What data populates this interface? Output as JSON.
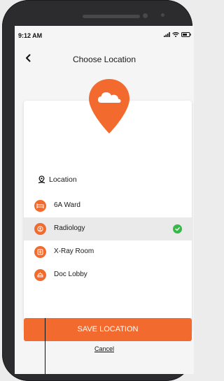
{
  "status_bar": {
    "time": "9:12 AM"
  },
  "header": {
    "title": "Choose Location",
    "back_icon": "chevron-left-icon"
  },
  "card": {
    "pin_icon": "cloud-map-pin-icon",
    "section_label": "Location",
    "section_icon": "person-pin-icon",
    "items": [
      {
        "label": "6A Ward",
        "icon": "bed-icon",
        "selected": false
      },
      {
        "label": "Radiology",
        "icon": "scan-icon",
        "selected": true
      },
      {
        "label": "X-Ray Room",
        "icon": "xray-icon",
        "selected": false
      },
      {
        "label": "Doc Lobby",
        "icon": "lobby-icon",
        "selected": false
      }
    ]
  },
  "actions": {
    "save_label": "SAVE LOCATION",
    "cancel_label": "Cancel"
  },
  "colors": {
    "accent": "#f26a2e",
    "check": "#38b84a",
    "selected_row": "#eaeaea"
  }
}
